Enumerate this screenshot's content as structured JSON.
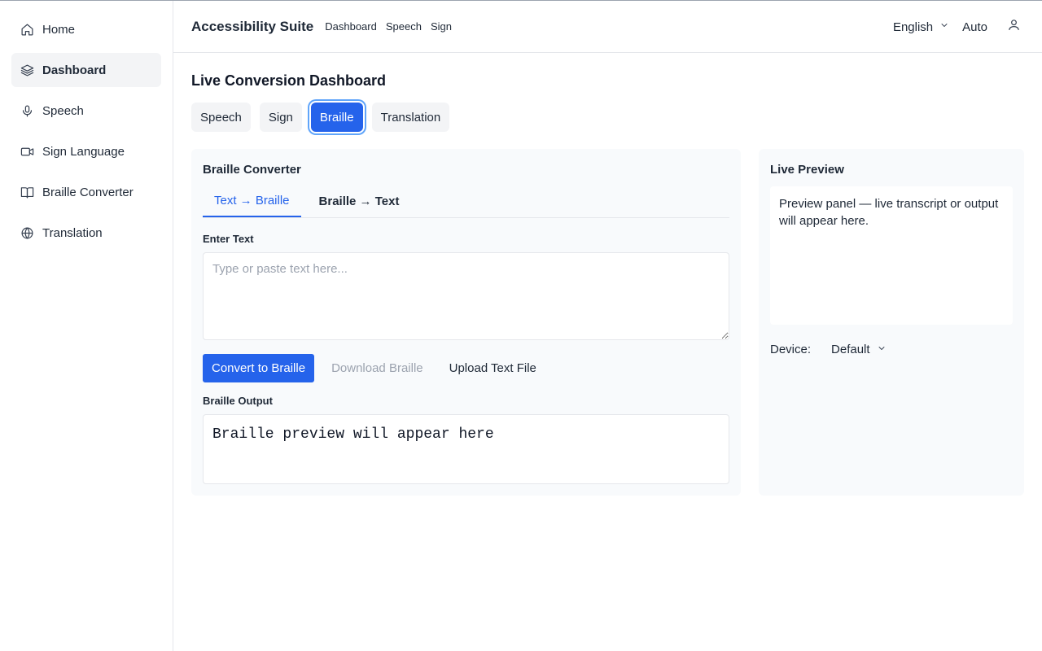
{
  "sidebar": {
    "items": [
      {
        "label": "Home",
        "icon": "home-icon"
      },
      {
        "label": "Dashboard",
        "icon": "layers-icon",
        "active": true
      },
      {
        "label": "Speech",
        "icon": "microphone-icon"
      },
      {
        "label": "Sign Language",
        "icon": "video-icon"
      },
      {
        "label": "Braille Converter",
        "icon": "book-icon"
      },
      {
        "label": "Translation",
        "icon": "globe-icon"
      }
    ]
  },
  "header": {
    "brand": "Accessibility Suite",
    "links": [
      "Dashboard",
      "Speech",
      "Sign"
    ],
    "language": "English",
    "mode": "Auto",
    "user_icon": "user-icon"
  },
  "main": {
    "title": "Live Conversion Dashboard",
    "mode_tabs": [
      "Speech",
      "Sign",
      "Braille",
      "Translation"
    ],
    "active_mode_tab": "Braille",
    "converter": {
      "title": "Braille Converter",
      "subtabs": [
        "Text → Braille",
        "Braille → Text"
      ],
      "active_subtab": "Text → Braille",
      "input_label": "Enter Text",
      "input_placeholder": "Type or paste text here...",
      "input_value": "",
      "convert_label": "Convert to Braille",
      "download_label": "Download Braille",
      "upload_label": "Upload Text File",
      "output_label": "Braille Output",
      "output_text": "Braille preview will appear here"
    },
    "preview": {
      "title": "Live Preview",
      "text": "Preview panel — live transcript or output will appear here.",
      "device_label": "Device:",
      "device_value": "Default"
    }
  },
  "colors": {
    "accent": "#2563eb",
    "panel_bg": "#f8fafc",
    "muted_text": "#9ca3af"
  }
}
